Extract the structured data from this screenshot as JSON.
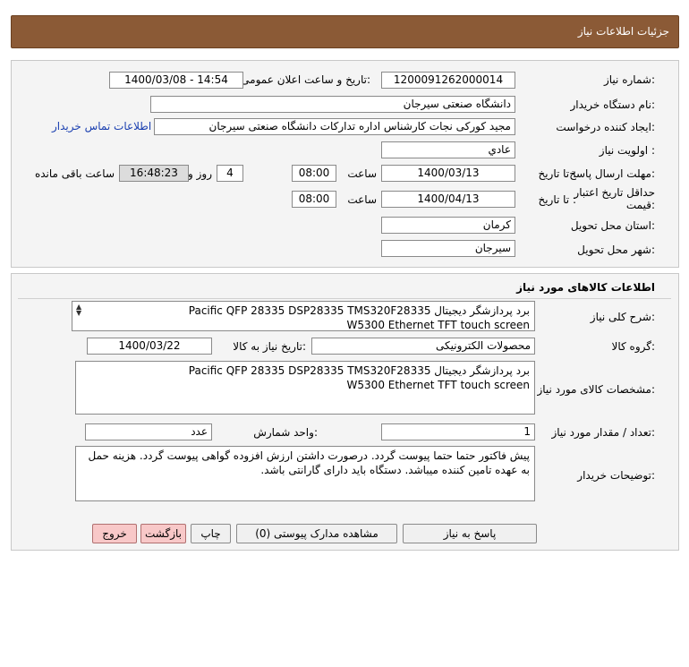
{
  "header": {
    "title": "جزئیات اطلاعات نیاز"
  },
  "info": {
    "need_number_label": "شماره نیاز:",
    "need_number": "1200091262000014",
    "announce_label": "تاریخ و ساعت اعلان عمومی:",
    "announce_value": "1400/03/08 - 14:54",
    "buyer_org_label": "نام دستگاه خریدار:",
    "buyer_org": "دانشگاه صنعتی سیرجان",
    "creator_label": "ایجاد کننده درخواست:",
    "creator": "مجید کورکی نجات کارشناس اداره تدارکات دانشگاه صنعتی سیرجان",
    "contact_link": "اطلاعات تماس خریدار",
    "priority_label": "اولویت نیاز :",
    "priority": "عادي",
    "deadline_label": "مهلت ارسال پاسخ:",
    "to_date_label": "تا تاریخ :",
    "deadline_date": "1400/03/13",
    "time_label": "ساعت",
    "deadline_time": "08:00",
    "days": "4",
    "days_label": "روز و",
    "remaining_time": "16:48:23",
    "remaining_label": "ساعت باقی مانده",
    "validity_label": "حداقل تاریخ اعتبار قیمت:",
    "validity_to_label": "تا تاریخ :",
    "validity_date": "1400/04/13",
    "validity_time_label": "ساعت",
    "validity_time": "08:00",
    "province_label": "استان محل تحویل:",
    "province": "کرمان",
    "city_label": "شهر محل تحویل:",
    "city": "سیرجان"
  },
  "goods": {
    "section_title": "اطلاعات کالاهای مورد نیاز",
    "general_desc_label": "شرح کلی نیاز:",
    "general_desc_line1": "برد پردازشگر دیجیتال Pacific QFP 28335 DSP28335 TMS320F28335",
    "general_desc_line2": "W5300 Ethernet TFT touch screen",
    "group_label": "گروه کالا:",
    "group": "محصولات الکترونیکی",
    "need_date_label": "تاریخ نیاز به کالا:",
    "need_date": "1400/03/22",
    "spec_label": "مشخصات کالای مورد نیاز:",
    "spec_line1": "برد پردازشگر دیجیتال Pacific QFP 28335 DSP28335 TMS320F28335",
    "spec_line2": "W5300 Ethernet TFT touch screen",
    "qty_label": "تعداد / مقدار مورد نیاز:",
    "qty": "1",
    "unit_label": "واحد شمارش:",
    "unit": "عدد",
    "buyer_notes_label": "توضیحات خریدار:",
    "buyer_notes": "پیش فاکتور حتما حتما پیوست گردد. درصورت داشتن ارزش افزوده گواهی پیوست گردد. هزینه حمل به عهده تامین کننده میباشد. دستگاه باید دارای گارانتی باشد."
  },
  "buttons": {
    "reply": "پاسخ به نیاز",
    "attachments": "مشاهده مدارک پیوستی (0)",
    "print": "چاپ",
    "back": "بازگشت",
    "exit": "خروج"
  }
}
